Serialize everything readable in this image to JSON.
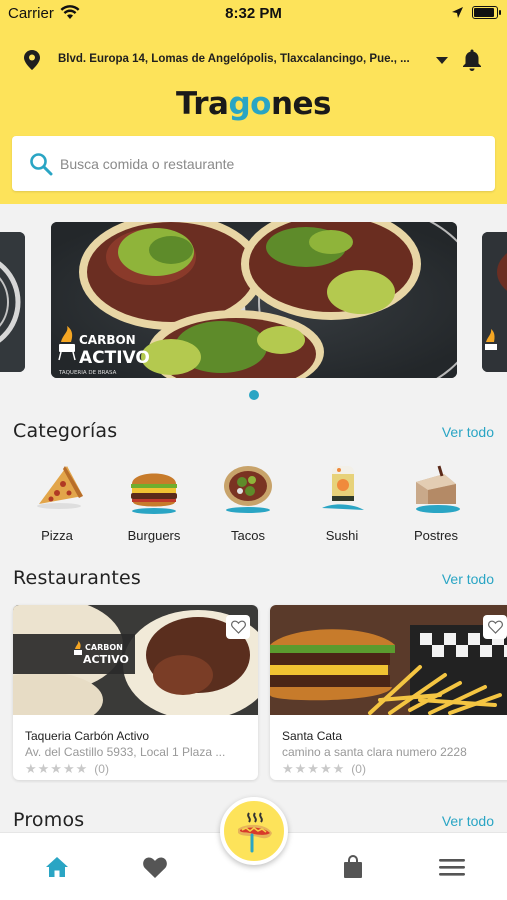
{
  "status_bar": {
    "carrier": "Carrier",
    "time": "8:32 PM"
  },
  "header": {
    "address": "Blvd. Europa 14, Lomas de Angelópolis, Tlaxcalancingo, Pue., ...",
    "logo_part1": "Tra",
    "logo_part2": "go",
    "logo_part3": "nes"
  },
  "search": {
    "placeholder": "Busca comida o restaurante"
  },
  "carousel": {
    "slides": 3,
    "active_index": 0,
    "banner_brand": "CARBON ACTIVO",
    "banner_sub": "TAQUERIA DE BRASA"
  },
  "categories_section": {
    "title": "Categorías",
    "see_all": "Ver todo",
    "items": [
      {
        "label": "Pizza",
        "icon": "pizza-icon"
      },
      {
        "label": "Burguers",
        "icon": "burger-icon"
      },
      {
        "label": "Tacos",
        "icon": "tacos-icon"
      },
      {
        "label": "Sushi",
        "icon": "sushi-icon"
      },
      {
        "label": "Postres",
        "icon": "dessert-icon"
      }
    ]
  },
  "restaurants_section": {
    "title": "Restaurantes",
    "see_all": "Ver todo",
    "items": [
      {
        "name": "Taqueria Carbón Activo",
        "address": "Av. del Castillo 5933, Local 1 Plaza ...",
        "stars": "★★★★★",
        "rating_count": "(0)",
        "logo_text": "CARBON ACTIVO"
      },
      {
        "name": "Santa Cata",
        "address": "camino a santa clara numero 2228",
        "stars": "★★★★★",
        "rating_count": "(0)"
      }
    ]
  },
  "promos_section": {
    "title": "Promos",
    "see_all": "Ver todo"
  },
  "bottom_nav": {
    "items": [
      {
        "name": "home",
        "icon": "home-icon",
        "active": true
      },
      {
        "name": "favorites",
        "icon": "heart-icon",
        "active": false
      },
      {
        "name": "center",
        "icon": "hotdog-icon",
        "active": false
      },
      {
        "name": "orders",
        "icon": "bag-icon",
        "active": false
      },
      {
        "name": "menu",
        "icon": "menu-icon",
        "active": false
      }
    ]
  },
  "colors": {
    "brand_yellow": "#fde35a",
    "accent_teal": "#2aa5c4",
    "text_dark": "#222222"
  }
}
